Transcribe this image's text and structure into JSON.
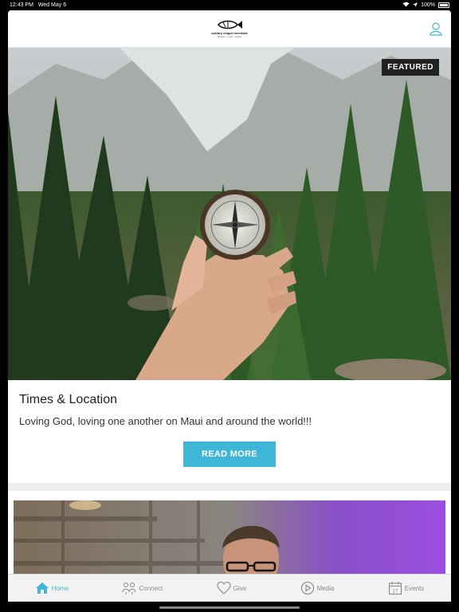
{
  "status": {
    "time": "12:43 PM",
    "date": "Wed May 6",
    "battery": "100%"
  },
  "header": {
    "logo_name": "calvary chapel westside",
    "logo_tagline": "lahaina · maui · hawaii"
  },
  "featured_card": {
    "badge": "FEATURED",
    "title": "Times & Location",
    "description": "Loving God, loving one another on Maui and around the world!!!",
    "button_label": "READ MORE"
  },
  "tabs": [
    {
      "label": "Home",
      "icon": "home-icon",
      "active": true
    },
    {
      "label": "Connect",
      "icon": "people-icon",
      "active": false
    },
    {
      "label": "Give",
      "icon": "heart-icon",
      "active": false
    },
    {
      "label": "Media",
      "icon": "play-icon",
      "active": false
    },
    {
      "label": "Events",
      "icon": "calendar-icon",
      "active": false
    }
  ],
  "calendar_day": "17",
  "colors": {
    "accent": "#3fb6d6",
    "badge_bg": "#222222"
  }
}
